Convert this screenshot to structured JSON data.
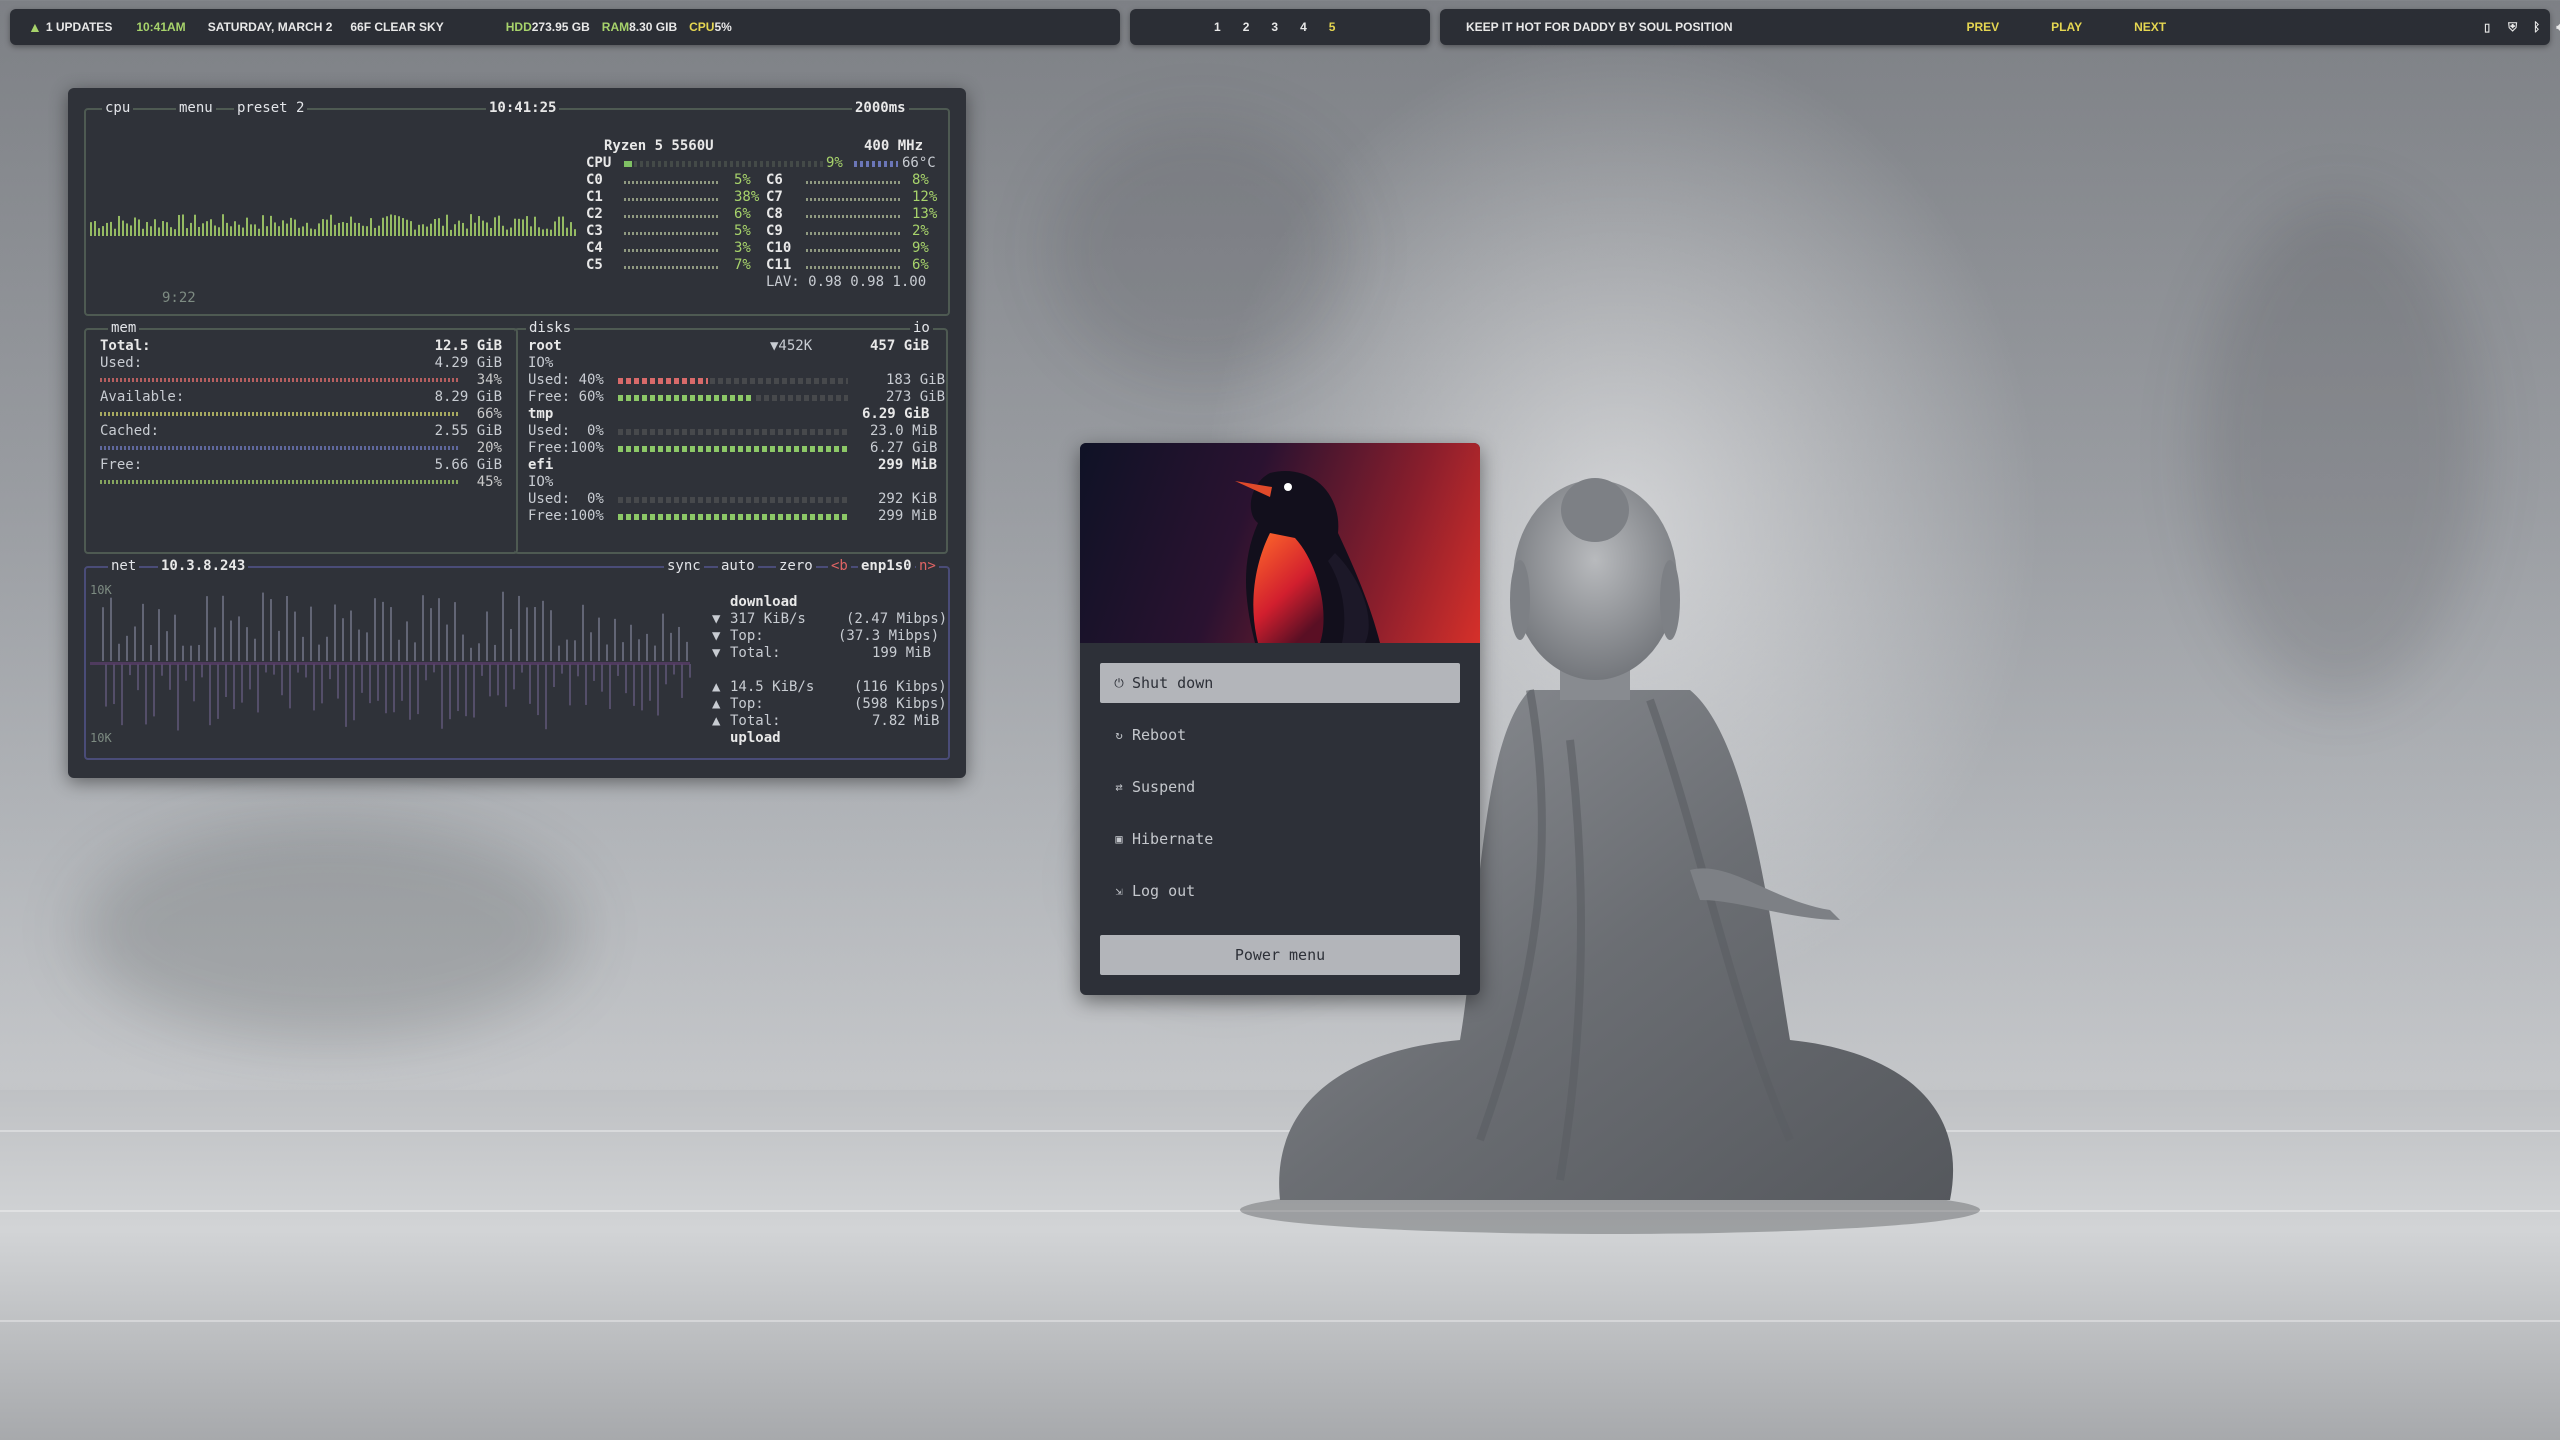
{
  "topbar_left": {
    "updates": "1 UPDATES",
    "time": "10:41AM",
    "date": "SATURDAY, MARCH  2",
    "weather": "66F CLEAR SKY",
    "hdd_label": "HDD",
    "hdd_value": "273.95 GB",
    "ram_label": "RAM",
    "ram_value": "8.30 GIB",
    "cpu_label": "CPU",
    "cpu_value": "5%"
  },
  "workspaces": [
    "1",
    "2",
    "3",
    "4",
    "5"
  ],
  "active_workspace": "5",
  "media": {
    "track": "KEEP IT HOT FOR DADDY BY  SOUL POSITION",
    "prev": "PREV",
    "play": "PLAY",
    "next": "NEXT"
  },
  "tray_icons": [
    "battery-icon",
    "shield-icon",
    "bluetooth-icon",
    "volume-icon",
    "screen-icon"
  ],
  "btop": {
    "cpu_box": {
      "title_cpu": "cpu",
      "title_menu": "menu",
      "title_preset": "preset 2",
      "clock": "10:41:25",
      "interval": "2000ms",
      "uptime": "9:22",
      "model": "Ryzen 5 5560U",
      "freq": "400 MHz",
      "cpu_label": "CPU",
      "cpu_pct": "9%",
      "cpu_temp": "66°C",
      "cores_left": [
        {
          "name": "C0",
          "pct": "5%"
        },
        {
          "name": "C1",
          "pct": "38%"
        },
        {
          "name": "C2",
          "pct": "6%"
        },
        {
          "name": "C3",
          "pct": "5%"
        },
        {
          "name": "C4",
          "pct": "3%"
        },
        {
          "name": "C5",
          "pct": "7%"
        }
      ],
      "cores_right": [
        {
          "name": "C6",
          "pct": "8%"
        },
        {
          "name": "C7",
          "pct": "12%"
        },
        {
          "name": "C8",
          "pct": "13%"
        },
        {
          "name": "C9",
          "pct": "2%"
        },
        {
          "name": "C10",
          "pct": "9%"
        },
        {
          "name": "C11",
          "pct": "6%"
        }
      ],
      "lav": "LAV: 0.98 0.98 1.00"
    },
    "mem_box": {
      "title": "mem",
      "rows": [
        {
          "label": "Total:",
          "value": "12.5 GiB",
          "bold": true
        },
        {
          "label": "Used:",
          "value": "4.29 GiB",
          "pct": "34%"
        },
        {
          "label": "Available:",
          "value": "8.29 GiB",
          "pct": "66%"
        },
        {
          "label": "Cached:",
          "value": "2.55 GiB",
          "pct": "20%"
        },
        {
          "label": "Free:",
          "value": "5.66 GiB",
          "pct": "45%"
        }
      ]
    },
    "disks_box": {
      "title": "disks",
      "io_tag": "io",
      "root": {
        "name": "root",
        "io_rate": "▼452K",
        "size": "457 GiB",
        "io_label": "IO%",
        "used_label": "Used: 40%",
        "used_val": "183 GiB",
        "free_label": "Free: 60%",
        "free_val": "273 GiB"
      },
      "tmp": {
        "name": "tmp",
        "size": "6.29 GiB",
        "used_label": "Used:  0%",
        "used_val": "23.0 MiB",
        "free_label": "Free:100%",
        "free_val": "6.27 GiB"
      },
      "efi": {
        "name": "efi",
        "size": "299 MiB",
        "io_label": "IO%",
        "used_label": "Used:  0%",
        "used_val": "292 KiB",
        "free_label": "Free:100%",
        "free_val": "299 MiB"
      }
    },
    "net_box": {
      "title": "net",
      "ip": "10.3.8.243",
      "sync": "sync",
      "auto": "auto",
      "zero": "zero",
      "prev_btn": "<b",
      "iface": "enp1s0",
      "next_btn": "n>",
      "scale_top": "10K",
      "scale_bottom": "10K",
      "download_label": "download",
      "dl_rate": "317 KiB/s",
      "dl_rate_bits": "(2.47 Mibps)",
      "dl_top_label": "Top:",
      "dl_top": "(37.3 Mibps)",
      "dl_total_label": "Total:",
      "dl_total": "199 MiB",
      "ul_rate": "14.5 KiB/s",
      "ul_rate_bits": "(116 Kibps)",
      "ul_top_label": "Top:",
      "ul_top": "(598 Kibps)",
      "ul_total_label": "Total:",
      "ul_total": "7.82 MiB",
      "upload_label": "upload"
    }
  },
  "power_menu": {
    "items": [
      {
        "icon": "power-icon",
        "label": "Shut down"
      },
      {
        "icon": "reboot-icon",
        "label": "Reboot"
      },
      {
        "icon": "suspend-icon",
        "label": "Suspend"
      },
      {
        "icon": "hibernate-icon",
        "label": "Hibernate"
      },
      {
        "icon": "logout-icon",
        "label": "Log out"
      }
    ],
    "selected_index": 0,
    "footer": "Power menu"
  }
}
